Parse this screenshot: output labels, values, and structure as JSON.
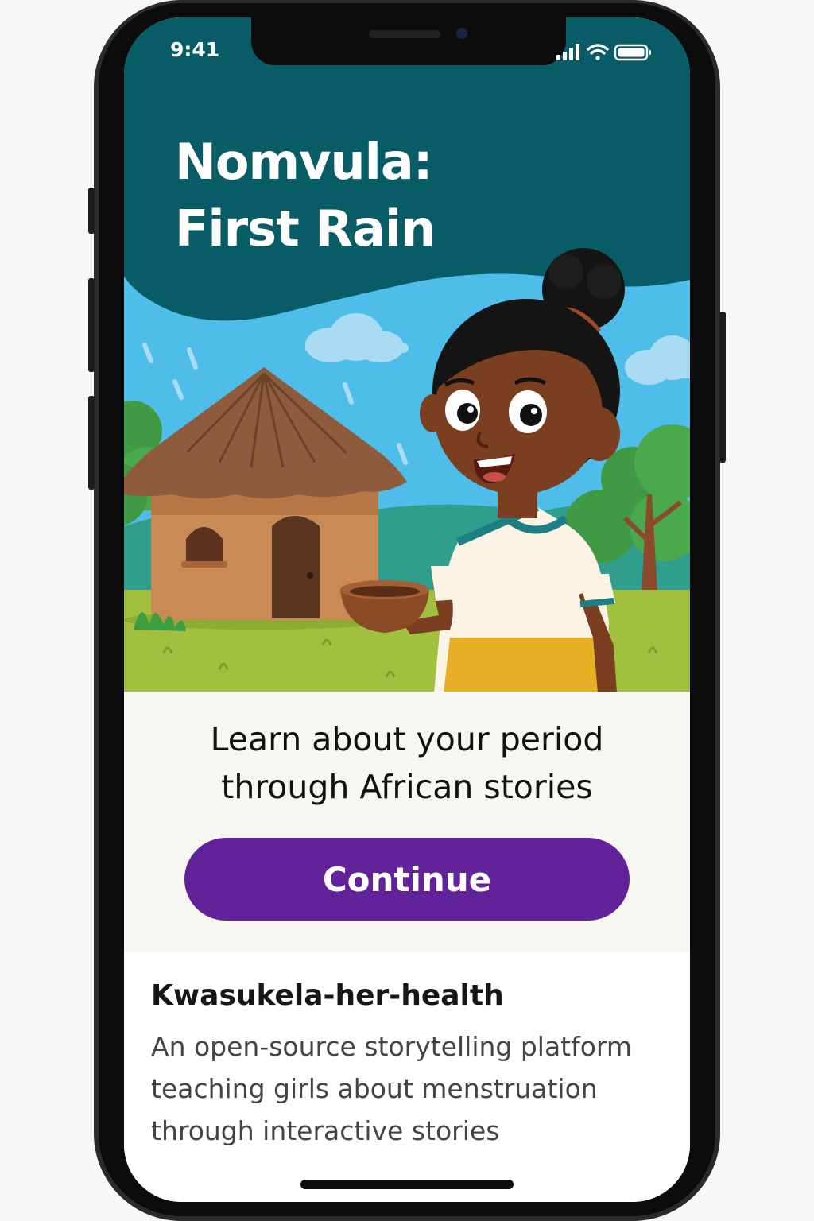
{
  "status_bar": {
    "time": "9:41"
  },
  "story": {
    "title_line1": "Nomvula:",
    "title_line2": "First Rain"
  },
  "onboarding": {
    "tagline_line1": "Learn about your period",
    "tagline_line2": "through African stories",
    "continue_label": "Continue"
  },
  "app_info": {
    "name": "Kwasukela-her-health",
    "description": "An open-source storytelling platform teaching girls about menstruation through interactive stories"
  },
  "colors": {
    "header_teal": "#085c66",
    "sky_blue": "#4fbde9",
    "accent_purple": "#62239a",
    "panel_cream": "#f8f6f1"
  },
  "icons": [
    "cellular-signal-icon",
    "wifi-icon",
    "battery-icon"
  ]
}
